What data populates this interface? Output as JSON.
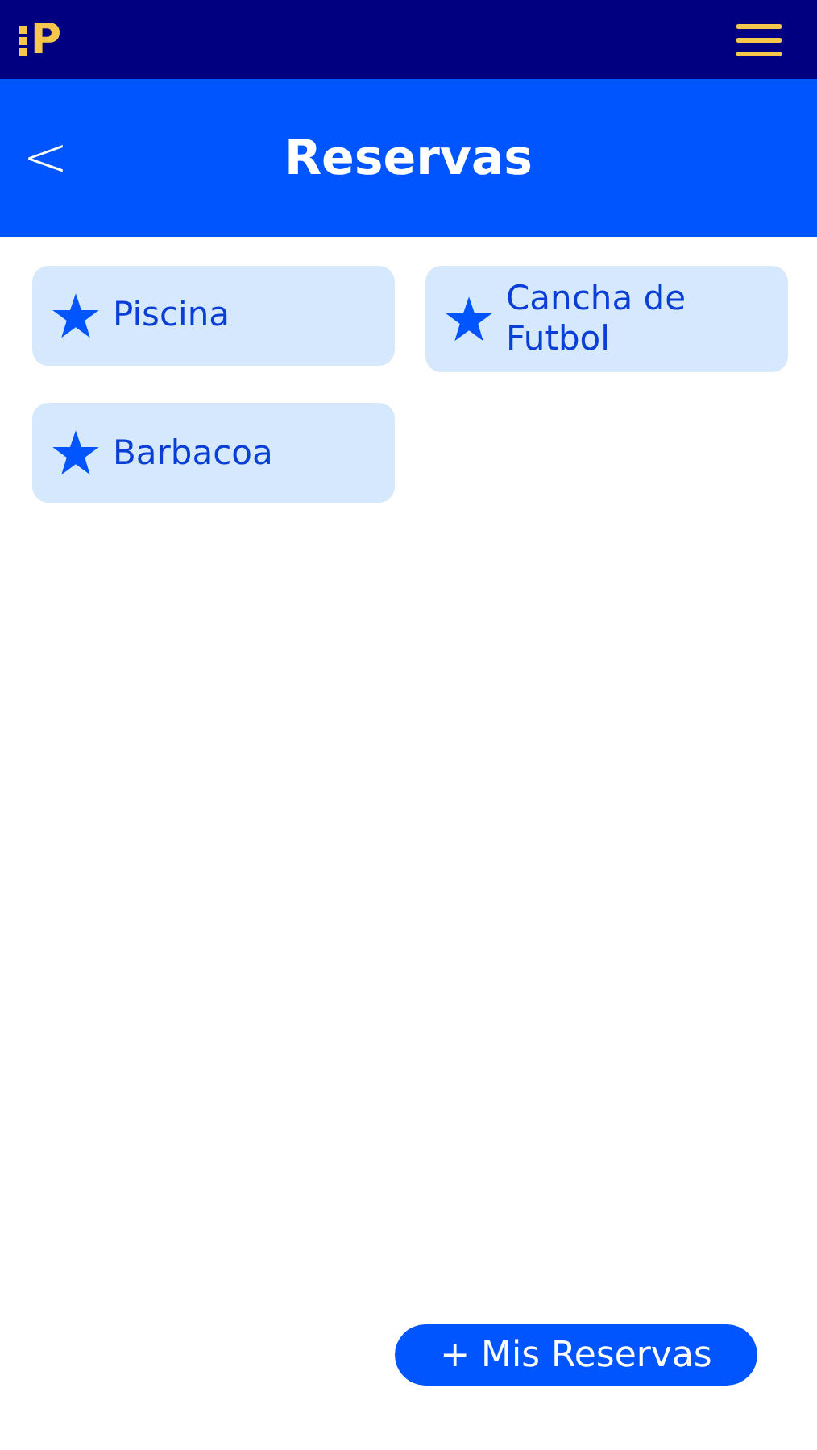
{
  "top_bar": {
    "logo": "P"
  },
  "header": {
    "back": "<",
    "title": "Reservas"
  },
  "amenities": [
    {
      "label": "Piscina"
    },
    {
      "label": "Cancha de Futbol"
    },
    {
      "label": "Barbacoa"
    }
  ],
  "action_button": {
    "label": "+ Mis Reservas"
  }
}
